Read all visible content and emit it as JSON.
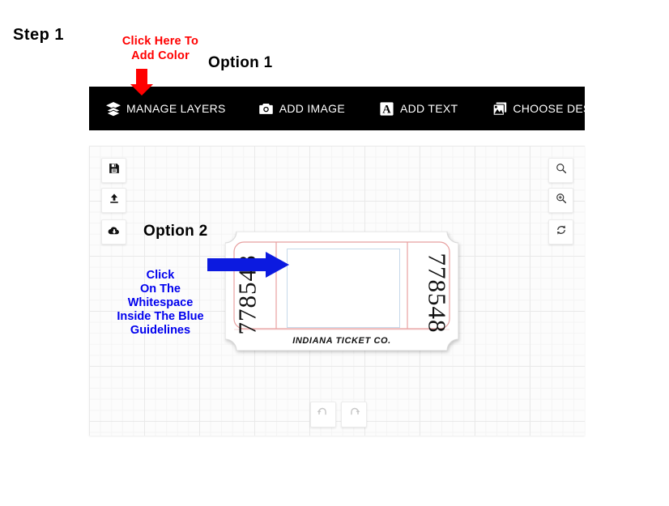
{
  "annotations": {
    "step_label": "Step 1",
    "click_color_note": "Click Here To\nAdd Color",
    "click_color_line1": "Click Here To",
    "click_color_line2": "Add Color",
    "option1_label": "Option 1",
    "option2_label": "Option 2",
    "click_whitespace_line1": "Click",
    "click_whitespace_line2": "On The",
    "click_whitespace_line3": "Whitespace",
    "click_whitespace_line4": "Inside The Blue",
    "click_whitespace_line5": "Guidelines",
    "red_arrow_icon": "arrow-down-icon",
    "blue_arrow_icon": "arrow-right-icon",
    "red_color": "#ff0000",
    "blue_color": "#0000ee"
  },
  "toolbar": {
    "background_color": "#000000",
    "text_color": "#ffffff",
    "items": [
      {
        "id": "manage-layers",
        "label": "MANAGE LAYERS",
        "icon": "layers-icon"
      },
      {
        "id": "add-image",
        "label": "ADD IMAGE",
        "icon": "camera-icon"
      },
      {
        "id": "add-text",
        "label": "ADD TEXT",
        "icon": "text-a-icon"
      },
      {
        "id": "choose-designs",
        "label": "CHOOSE DESIGNS",
        "icon": "gallery-icon"
      }
    ]
  },
  "canvas": {
    "left_tools": [
      {
        "id": "save",
        "icon": "floppy-disk-icon",
        "title": "Save"
      },
      {
        "id": "upload",
        "icon": "upload-arrow-icon",
        "title": "Upload"
      },
      {
        "id": "cloud",
        "icon": "cloud-download-icon",
        "title": "Load from cloud"
      }
    ],
    "right_tools": [
      {
        "id": "zoom-out",
        "icon": "magnifier-icon",
        "title": "Zoom out"
      },
      {
        "id": "zoom-in",
        "icon": "magnifier-plus-icon",
        "title": "Zoom in"
      },
      {
        "id": "reset",
        "icon": "refresh-icon",
        "title": "Reset"
      }
    ],
    "history_tools": [
      {
        "id": "undo",
        "icon": "undo-arrow-icon",
        "title": "Undo",
        "disabled": true
      },
      {
        "id": "redo",
        "icon": "redo-arrow-icon",
        "title": "Redo",
        "disabled": true
      }
    ]
  },
  "ticket": {
    "serial_left": "778548",
    "serial_right": "778548",
    "company": "INDIANA TICKET CO.",
    "guideline_color": "#c6d9ea",
    "outline_color": "#e8a0a0",
    "body_color": "#ffffff"
  }
}
